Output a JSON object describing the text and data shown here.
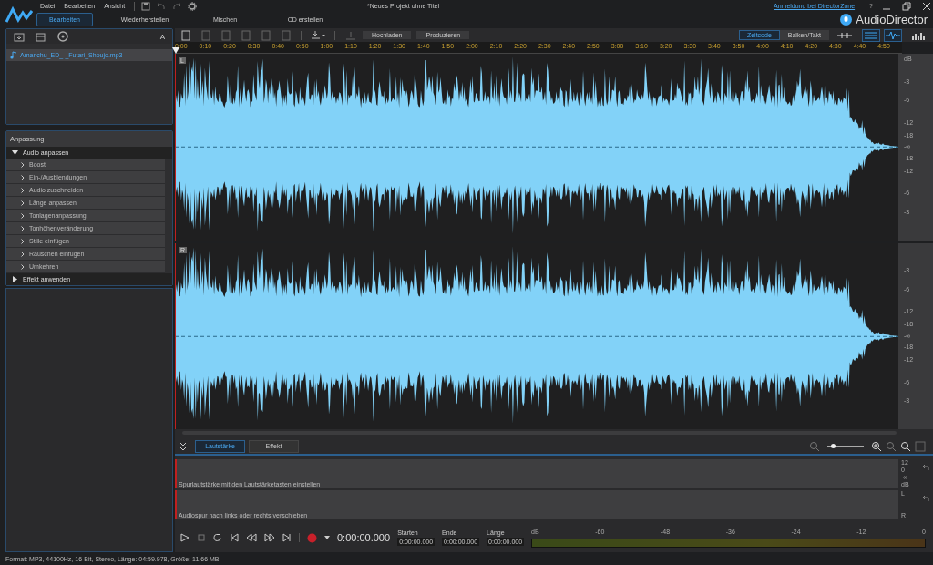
{
  "menu": [
    "Datei",
    "Bearbeiten",
    "Ansicht"
  ],
  "title": "*Neues Projekt ohne Titel",
  "login_link": "Anmeldung bei DirectorZone",
  "help": "?",
  "brand": "AudioDirector",
  "mode_tabs": [
    {
      "label": "Bearbeiten",
      "selected": true
    },
    {
      "label": "Wiederherstellen",
      "selected": false
    },
    {
      "label": "Mischen",
      "selected": false
    },
    {
      "label": "CD erstellen",
      "selected": false
    }
  ],
  "library": {
    "font_button": "A",
    "files": [
      {
        "name": "Amanchu_ED_-_Futari_Shoujo.mp3",
        "selected": true
      }
    ]
  },
  "adjust": {
    "title": "Anpassung",
    "groups": [
      {
        "label": "Audio anpassen",
        "expanded": true,
        "children": [
          "Boost",
          "Ein-/Ausblendungen",
          "Audio zuschneiden",
          "Länge anpassen",
          "Tonlagenanpassung",
          "Tonhöhenveränderung",
          "Stille einfügen",
          "Rauschen einfügen",
          "Umkehren"
        ]
      },
      {
        "label": "Effekt anwenden",
        "expanded": false
      }
    ]
  },
  "toolbar": {
    "buttons": [
      "Hochladen",
      "Produzieren"
    ],
    "view_modes": [
      {
        "label": "Zeitcode",
        "selected": true
      },
      {
        "label": "Balken/Takt",
        "selected": false
      }
    ]
  },
  "ruler": [
    "0:00",
    "0:10",
    "0:20",
    "0:30",
    "0:40",
    "0:50",
    "1:00",
    "1:10",
    "1:20",
    "1:30",
    "1:40",
    "1:50",
    "2:00",
    "2:10",
    "2:20",
    "2:30",
    "2:40",
    "2:50",
    "3:00",
    "3:10",
    "3:20",
    "3:30",
    "3:40",
    "3:50",
    "4:00",
    "4:10",
    "4:20",
    "4:30",
    "4:40",
    "4:50"
  ],
  "scale_unit": "dB",
  "tracks": [
    {
      "channel": "L",
      "scale": [
        "-3",
        "-6",
        "-12",
        "-18",
        "-∞",
        "-18",
        "-12",
        "-6",
        "-3"
      ]
    },
    {
      "channel": "R",
      "scale": [
        "-3",
        "-6",
        "-12",
        "-18",
        "-∞",
        "-18",
        "-12",
        "-6",
        "-3"
      ]
    }
  ],
  "bottom_tabs": [
    {
      "label": "Lautstärke",
      "selected": true
    },
    {
      "label": "Effekt",
      "selected": false
    }
  ],
  "zoom": {
    "level": 0.15
  },
  "lanes": [
    {
      "hint": "Spurlautstärke mit den Lautstärketasten einstellen",
      "color": "#b8962e",
      "scale": [
        "12",
        "0",
        "-∞",
        "dB"
      ]
    },
    {
      "hint": "Audiospur nach links oder rechts verschieben",
      "color": "#6d8f2c",
      "scale": [
        "L",
        "R"
      ]
    }
  ],
  "transport": {
    "time": "0:00:00.000",
    "fields": [
      {
        "label": "Starten",
        "value": "0:00:00.000"
      },
      {
        "label": "Ende",
        "value": "0:00:00.000"
      },
      {
        "label": "Länge",
        "value": "0:00:00.000"
      }
    ]
  },
  "meter": {
    "scale": [
      "dB",
      "-60",
      "-48",
      "-36",
      "-24",
      "-12",
      "0"
    ]
  },
  "status": "Format: MP3, 44100Hz, 16-Bit, Stereo, Länge: 04:59.978, Größe: 11.66 MB"
}
